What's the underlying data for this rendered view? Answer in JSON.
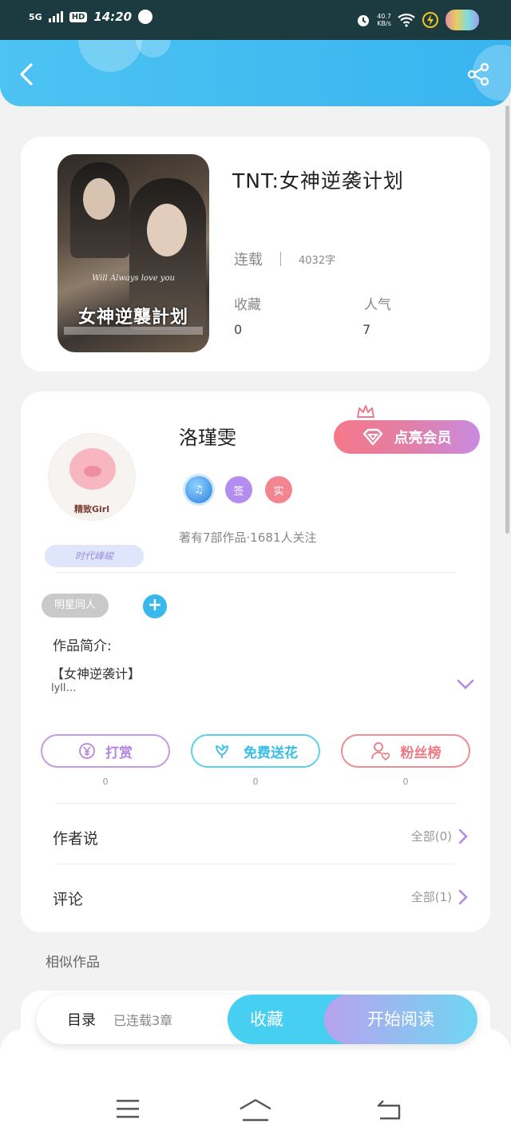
{
  "status_bar": {
    "network": "5G",
    "hd": "HD",
    "time": "14:20",
    "speed_value": "40.7",
    "speed_unit": "KB/s",
    "icons": [
      "signal-icon",
      "clock-icon",
      "alarm-icon",
      "wifi-icon",
      "battery-charging-icon",
      "rainbow-sticker-icon"
    ]
  },
  "header": {
    "back_icon": "back-icon",
    "share_icon": "share-icon",
    "gradient_start": "#4cc3f2",
    "gradient_end": "#39b4ef"
  },
  "book": {
    "title": "TNT:女神逆袭计划",
    "status": "连载",
    "word_count": "4032字",
    "stats": [
      {
        "label": "收藏",
        "value": "0"
      },
      {
        "label": "人气",
        "value": "7"
      }
    ],
    "cover": {
      "title": "女神逆襲計划",
      "subtitle": "Will Always love you"
    }
  },
  "author": {
    "name": "洛瑾雯",
    "avatar_label": "精致Girl",
    "badge": "时代峰峻",
    "vip_button": "点亮会员",
    "badges": [
      {
        "icon": "music-note-icon",
        "label": "♫"
      },
      {
        "icon": "sign-badge-icon",
        "label": "签"
      },
      {
        "icon": "real-badge-icon",
        "label": "实"
      }
    ],
    "stats_line": "著有7部作品·1681人关注"
  },
  "tags": {
    "items": [
      "明星同人"
    ],
    "add_label": "+"
  },
  "intro": {
    "label": "作品简介:",
    "text": "【女神逆袭计】",
    "more": "lyll…"
  },
  "actions": [
    {
      "label": "打赏",
      "icon": "yuan-icon",
      "count": "0",
      "color": "#b486e2"
    },
    {
      "label": "免费送花",
      "icon": "flower-icon",
      "count": "0",
      "color": "#38bde6"
    },
    {
      "label": "粉丝榜",
      "icon": "fans-icon",
      "count": "0",
      "color": "#ee7884"
    }
  ],
  "rows": [
    {
      "title": "作者说",
      "right": "全部(0)"
    },
    {
      "title": "评论",
      "right": "全部(1)"
    }
  ],
  "similar_label": "相似作品",
  "bottom_bar": {
    "toc_label": "目录",
    "toc_sub": "已连载3章",
    "favorite": "收藏",
    "read": "开始阅读"
  },
  "nav": {
    "icons": [
      "menu-icon",
      "home-icon",
      "back-nav-icon"
    ]
  }
}
